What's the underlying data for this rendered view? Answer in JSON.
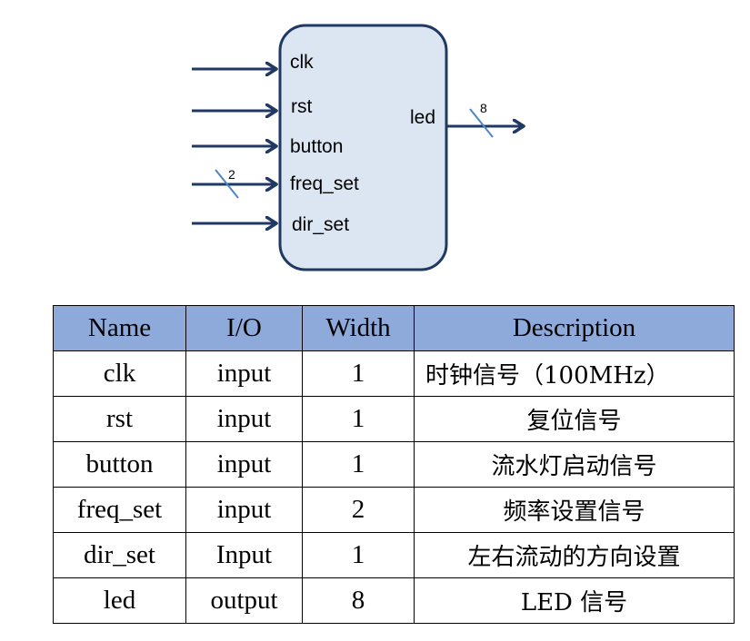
{
  "module": {
    "inputs": [
      {
        "name": "clk"
      },
      {
        "name": "rst"
      },
      {
        "name": "button"
      },
      {
        "name": "freq_set",
        "bus_width": "2"
      },
      {
        "name": "dir_set"
      }
    ],
    "outputs": [
      {
        "name": "led",
        "bus_width": "8"
      }
    ],
    "colors": {
      "block_fill": "#dce6f2",
      "block_stroke": "#1f3864",
      "arrow": "#1f3864",
      "bus_slash": "#4a86c8"
    }
  },
  "table": {
    "header_color": "#8eaadb",
    "headers": [
      "Name",
      "I/O",
      "Width",
      "Description"
    ],
    "rows": [
      [
        "clk",
        "input",
        "1",
        "时钟信号（100MHz）"
      ],
      [
        "rst",
        "input",
        "1",
        "复位信号"
      ],
      [
        "button",
        "input",
        "1",
        "流水灯启动信号"
      ],
      [
        "freq_set",
        "input",
        "2",
        "频率设置信号"
      ],
      [
        "dir_set",
        "Input",
        "1",
        "左右流动的方向设置"
      ],
      [
        "led",
        "output",
        "8",
        "LED 信号"
      ]
    ]
  }
}
